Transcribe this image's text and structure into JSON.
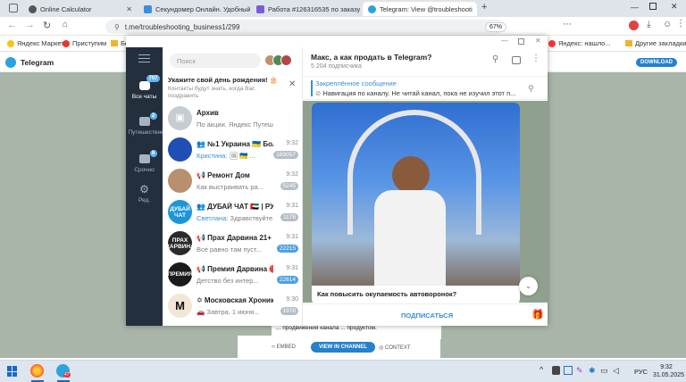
{
  "browser": {
    "tabs": [
      {
        "title": "Online Calculator",
        "active": false
      },
      {
        "title": "Секундомер Онлайн. Удобный",
        "active": false
      },
      {
        "title": "Работа #126316535 по заказу",
        "active": false
      },
      {
        "title": "Telegram: View @troubleshooti",
        "active": true
      }
    ],
    "new_tab": "+",
    "url": "t.me/troubleshooting_business1/299",
    "zoom": "67%",
    "bookmarks": [
      "Яндекс Маркет",
      "Приступим",
      "Бо",
      "Яндекс: нашло...",
      "Другие закладки"
    ]
  },
  "tg_web": {
    "brand": "Telegram",
    "download": "DOWNLOAD",
    "bubble_text": "... продвижения канала ... продуктом.",
    "embed": "EMBED",
    "view_in_channel": "VIEW IN CHANNEL",
    "context": "CONTEXT"
  },
  "app": {
    "nav": [
      {
        "label": "Все чаты",
        "badge": "707"
      },
      {
        "label": "Путешествие",
        "badge": "2"
      },
      {
        "label": "Срочно",
        "badge": "6"
      },
      {
        "label": "Ред.",
        "badge": ""
      }
    ],
    "search_placeholder": "Поиск",
    "birthday": {
      "title": "Укажите свой день рождения! 🎂",
      "subtitle": "Контакты будут знать, когда Вас поздравить"
    },
    "chats": [
      {
        "name": "Архив",
        "time": "",
        "sender": "",
        "preview": "По акции. Яндекс Путеш...",
        "count": "",
        "avatar_text": "",
        "avatar_color": "#c7ccd1",
        "count_blue": false
      },
      {
        "name": "👥 №1 Украина 🇺🇦 Болг...",
        "time": "9:32",
        "sender": "Кристина:",
        "preview": " 🖼 🇺🇦 ...",
        "count": "169057",
        "avatar_text": "",
        "avatar_color": "#1f4fb4",
        "count_blue": false
      },
      {
        "name": "📢 Ремонт Дом",
        "time": "9:32",
        "sender": "",
        "preview": "Как выстраивать ра...",
        "count": "5245",
        "avatar_text": "",
        "avatar_color": "#b88f6f",
        "count_blue": false
      },
      {
        "name": "👥 ДУБАЙ ЧАТ 🇦🇪 | РУС...",
        "time": "9:31",
        "sender": "Светлана:",
        "preview": " Здравствуйте...",
        "count": "1178",
        "avatar_text": "ДУБАЙ ЧАТ",
        "avatar_color": "#1d96d8",
        "count_blue": false
      },
      {
        "name": "📢 Прах Дарвина 21+",
        "time": "9:31",
        "sender": "",
        "preview": "Все равно там пуст...",
        "count": "22215",
        "avatar_text": "ПРАХ ДАРВИНА",
        "avatar_color": "#2a2a2a",
        "count_blue": true
      },
      {
        "name": "📢 Премия Дарвина 🔴",
        "time": "9:31",
        "sender": "",
        "preview": "Детство без интер...",
        "count": "22614",
        "avatar_text": "ПРЕМИЯ",
        "avatar_color": "#1b1b1b",
        "count_blue": true
      },
      {
        "name": "✡ Московская Хроника",
        "time": "9:30",
        "sender": "",
        "preview": "🚗 Завтра, 1 июня...",
        "count": "1978",
        "avatar_text": "M",
        "avatar_color": "#f2e6d6",
        "count_blue": false
      }
    ],
    "channel": {
      "title": "Макс, а как продать в Telegram?",
      "subscribers": "5 204 подписчика",
      "pinned_label": "Закреплённое сообщение",
      "pinned_text": "Навигация по каналу. Не читай канал, пока не изучил этот п...",
      "post_caption": "Как повысить окупаемость автоворонок?",
      "subscribe": "ПОДПИСАТЬСЯ"
    }
  },
  "taskbar": {
    "lang": "РУС",
    "time": "9:32",
    "date": "31.05.2025",
    "tg_badge": "47"
  }
}
